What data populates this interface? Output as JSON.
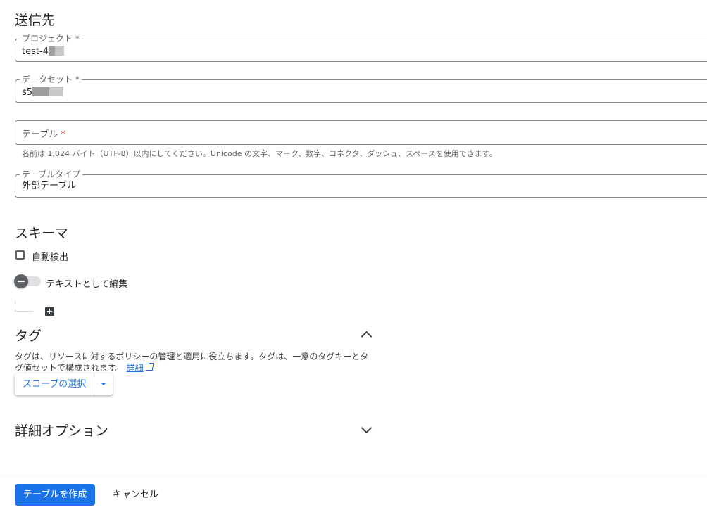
{
  "destination": {
    "title": "送信先",
    "project": {
      "label": "プロジェクト",
      "required_mark": "*",
      "value": "test-4"
    },
    "dataset": {
      "label": "データセット",
      "required_mark": "*",
      "value": "s5"
    },
    "table": {
      "placeholder": "テーブル",
      "required_mark": "*",
      "hint": "名前は 1,024 バイト（UTF-8）以内にしてください。Unicode の文字、マーク、数字、コネクタ、ダッシュ、スペースを使用できます。"
    },
    "table_type": {
      "label": "テーブルタイプ",
      "value": "外部テーブル"
    }
  },
  "schema": {
    "title": "スキーマ",
    "auto_detect_label": "自動検出",
    "auto_detect_checked": false,
    "edit_as_text_label": "テキストとして編集",
    "edit_as_text_on": false
  },
  "tags": {
    "title": "タグ",
    "expanded": true,
    "description": "タグは、リソースに対するポリシーの管理と適用に役立ちます。タグは、一意のタグキーとタグ値セットで構成されます。",
    "details_link": "詳細",
    "scope_button": "スコープの選択"
  },
  "advanced": {
    "title": "詳細オプション",
    "expanded": false
  },
  "footer": {
    "create_button": "テーブルを作成",
    "cancel_button": "キャンセル"
  },
  "colors": {
    "accent": "#1a73e8",
    "required": "#d93025",
    "border": "#80868b"
  }
}
